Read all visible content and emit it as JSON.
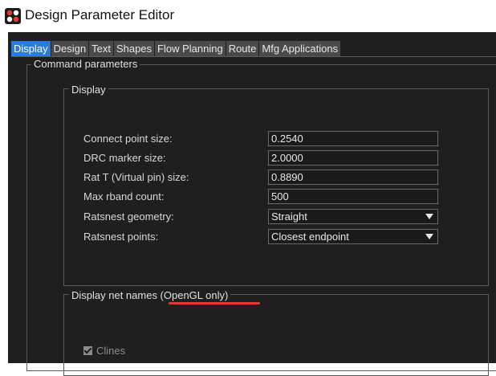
{
  "window": {
    "title": "Design Parameter Editor"
  },
  "tabs": [
    "Display",
    "Design",
    "Text",
    "Shapes",
    "Flow Planning",
    "Route",
    "Mfg Applications"
  ],
  "command_parameters": {
    "label": "Command parameters",
    "display_group": {
      "label": "Display",
      "fields": [
        {
          "label": "Connect point size:",
          "value": "0.2540"
        },
        {
          "label": "DRC marker size:",
          "value": "2.0000"
        },
        {
          "label": "Rat T (Virtual pin) size:",
          "value": "0.8890"
        },
        {
          "label": "Max rband count:",
          "value": "500"
        },
        {
          "label": "Ratsnest geometry:",
          "value": "Straight"
        },
        {
          "label": "Ratsnest points:",
          "value": "Closest endpoint"
        }
      ]
    },
    "net_names_group": {
      "label": "Display net names (OpenGL only)",
      "clines": {
        "label": "Clines",
        "checked": true
      }
    }
  },
  "colors": {
    "active_tab": "#2a7be0",
    "annotation_underline": "#e53935"
  }
}
